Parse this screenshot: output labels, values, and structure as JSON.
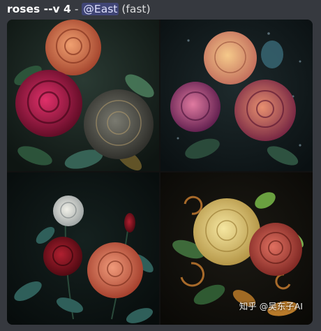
{
  "message": {
    "prompt": "roses --v 4",
    "separator": "-",
    "mention": "@East",
    "mode": "(fast)"
  },
  "image_grid": {
    "tiles": [
      {
        "subject": "red-orange-and-gray-roses"
      },
      {
        "subject": "pink-purple-roses-with-dew"
      },
      {
        "subject": "white-and-red-roses-dark-background"
      },
      {
        "subject": "yellow-and-red-roses-with-swirls"
      }
    ]
  },
  "watermark": {
    "text": "知乎 @吴东子AI"
  }
}
